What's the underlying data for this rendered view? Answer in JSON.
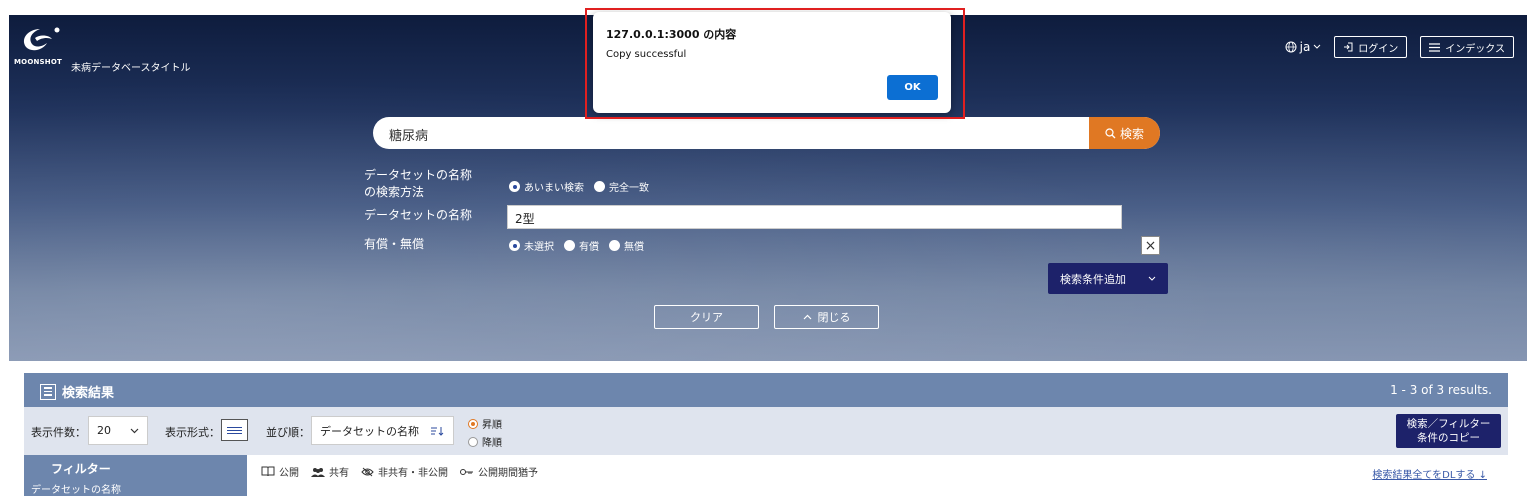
{
  "header": {
    "logo_word": "MOONSHOT",
    "site_title": "未病データベースタイトル",
    "lang": "ja",
    "login_label": "ログイン",
    "index_label": "インデックス"
  },
  "search": {
    "query": "糖尿病",
    "button_label": "検索"
  },
  "conditions": {
    "method_label_1": "データセットの名称",
    "method_label_2": "の検索方法",
    "method_options": [
      "あいまい検索",
      "完全一致"
    ],
    "name_label": "データセットの名称",
    "name_value": "2型",
    "paid_label": "有償・無償",
    "paid_options": [
      "未選択",
      "有償",
      "無償"
    ],
    "remove_symbol": "×",
    "add_condition_label": "検索条件追加",
    "clear_label": "クリア",
    "close_label": "閉じる"
  },
  "dialog": {
    "title": "127.0.0.1:3000 の内容",
    "message": "Copy successful",
    "ok_label": "OK"
  },
  "results": {
    "title": "検索結果",
    "count": "1 - 3 of 3 results.",
    "per_page_label": "表示件数：",
    "per_page_value": "20",
    "display_label": "表示形式：",
    "sort_label": "並び順：",
    "sort_value": "データセットの名称",
    "asc_label": "昇順",
    "desc_label": "降順",
    "copy_label_1": "検索／フィルター",
    "copy_label_2": "条件のコピー"
  },
  "filter": {
    "title": "フィルター",
    "first_item": "データセットの名称"
  },
  "legend": [
    "公開",
    "共有",
    "非共有・非公開",
    "公開期間猶予"
  ],
  "download_label": "検索結果全てをDLする"
}
